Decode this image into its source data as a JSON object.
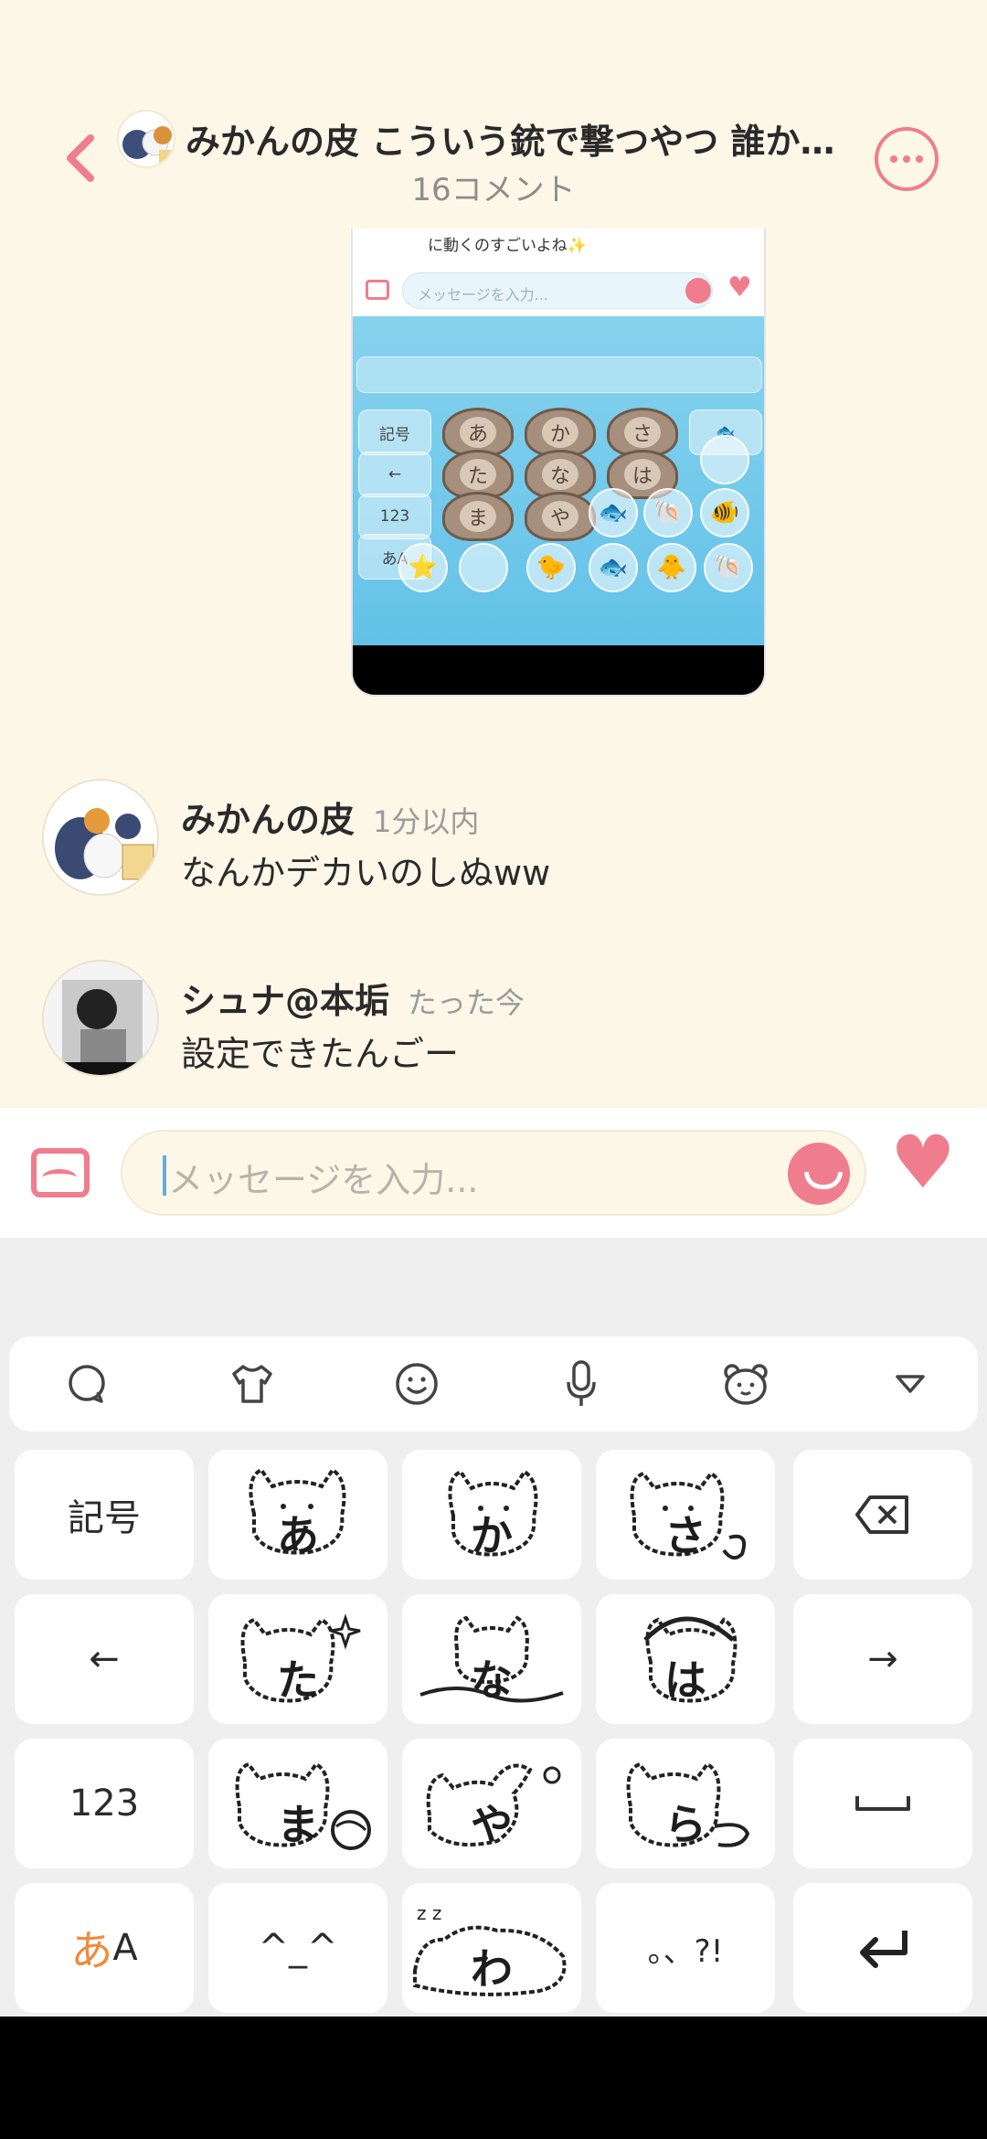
{
  "header": {
    "title": "みかんの皮 こういう銃で撃つやつ 誰か…",
    "subtitle": "16コメント"
  },
  "screenshot": {
    "caption": "に動くのすごいよね✨",
    "placeholder": "メッセージを入力...",
    "keys": {
      "symbols": "記号",
      "back": "←",
      "num": "123",
      "kana": "あA",
      "row1": [
        "あ",
        "か",
        "さ"
      ],
      "row2": [
        "た",
        "な",
        "は"
      ],
      "row3": [
        "ま",
        "や"
      ]
    }
  },
  "comments": [
    {
      "name": "みかんの皮",
      "time": "1分以内",
      "text": "なんかデカいのしぬww"
    },
    {
      "name": "シュナ@本垢",
      "time": "たった今",
      "text": "設定できたんごー"
    }
  ],
  "input": {
    "placeholder": "メッセージを入力..."
  },
  "keyboard": {
    "toolbar": [
      "search-icon",
      "shirt-icon",
      "emoji-icon",
      "mic-icon",
      "bear-face-icon",
      "collapse-icon"
    ],
    "keys": {
      "symbols": "記号",
      "left": "←",
      "right": "→",
      "num": "123",
      "kana_mode_a": "あ",
      "kana_mode_b": "A",
      "face": "^_^",
      "punct": "。、?!",
      "space": "␣"
    },
    "cats": {
      "a": "あ",
      "ka": "か",
      "sa": "さ",
      "ta": "た",
      "na": "な",
      "ha": "は",
      "ma": "ま",
      "ya": "や",
      "ra": "ら",
      "wa": "わ"
    }
  },
  "colors": {
    "accent": "#f07d8e",
    "background": "#fdf7e8"
  }
}
